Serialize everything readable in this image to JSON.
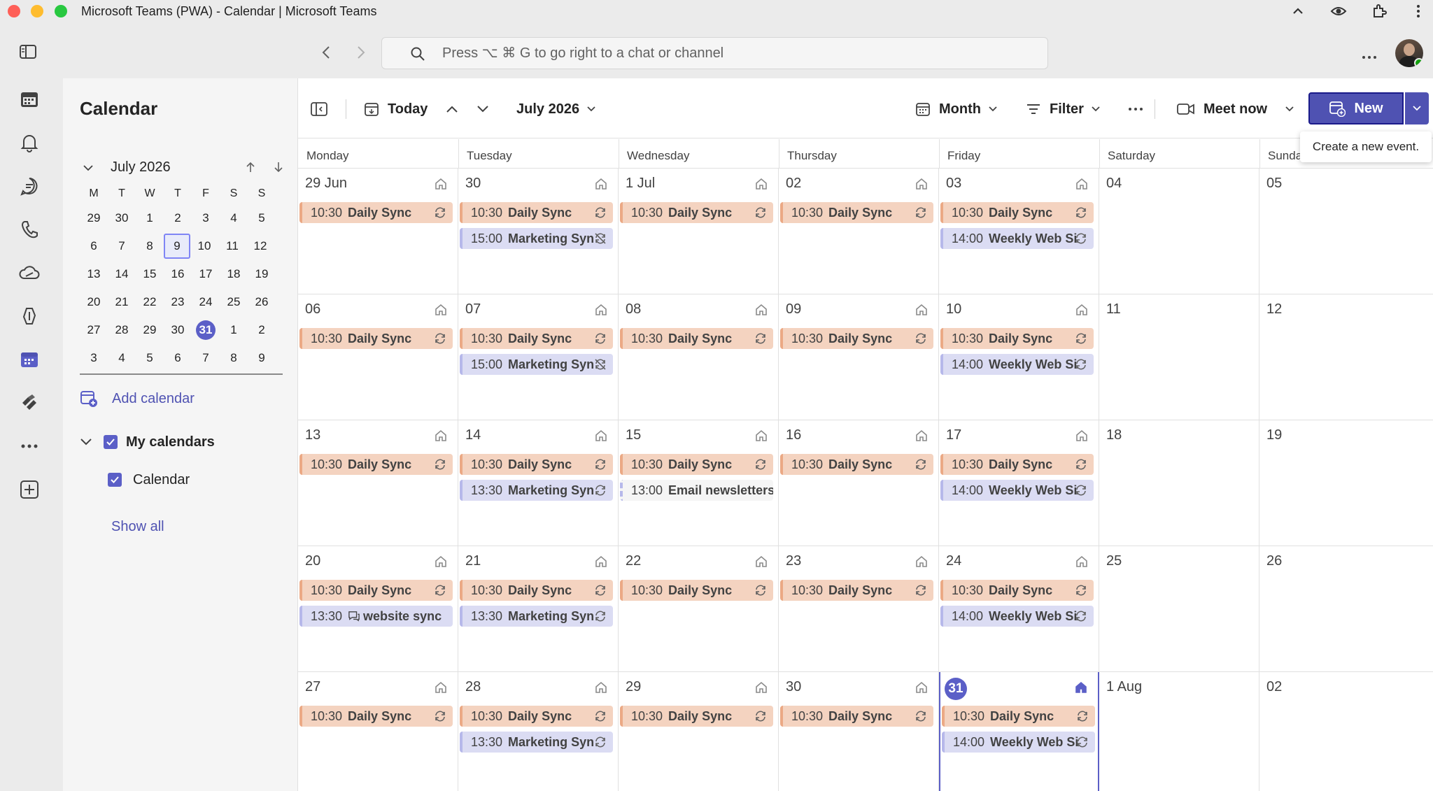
{
  "window": {
    "title": "Microsoft Teams (PWA) - Calendar | Microsoft Teams"
  },
  "search": {
    "placeholder": "Press ⌥ ⌘ G to go right to a chat or channel"
  },
  "sidebar": {
    "title": "Calendar",
    "mini_month": "July 2026",
    "dow": [
      "M",
      "T",
      "W",
      "T",
      "F",
      "S",
      "S"
    ],
    "weeks": [
      [
        "29",
        "30",
        "1",
        "2",
        "3",
        "4",
        "5"
      ],
      [
        "6",
        "7",
        "8",
        "9",
        "10",
        "11",
        "12"
      ],
      [
        "13",
        "14",
        "15",
        "16",
        "17",
        "18",
        "19"
      ],
      [
        "20",
        "21",
        "22",
        "23",
        "24",
        "25",
        "26"
      ],
      [
        "27",
        "28",
        "29",
        "30",
        "31",
        "1",
        "2"
      ],
      [
        "3",
        "4",
        "5",
        "6",
        "7",
        "8",
        "9"
      ]
    ],
    "add_calendar": "Add calendar",
    "my_calendars": "My calendars",
    "calendar_item": "Calendar",
    "show_all": "Show all"
  },
  "toolbar": {
    "today": "Today",
    "month_label": "July 2026",
    "view": "Month",
    "filter": "Filter",
    "meet_now": "Meet now",
    "new": "New",
    "tooltip": "Create a new event."
  },
  "grid": {
    "dow": [
      "Monday",
      "Tuesday",
      "Wednesday",
      "Thursday",
      "Friday",
      "Saturday",
      "Sunda"
    ],
    "weeks": [
      {
        "days": [
          "29 Jun",
          "30",
          "1 Jul",
          "02",
          "03",
          "04",
          "05"
        ],
        "events": [
          [
            {
              "time": "10:30",
              "name": "Daily Sync",
              "kind": "orange",
              "icon": "repeat"
            }
          ],
          [
            {
              "time": "10:30",
              "name": "Daily Sync",
              "kind": "orange",
              "icon": "repeat"
            },
            {
              "time": "15:00",
              "name": "Marketing Syn",
              "kind": "purple",
              "icon": "repeat-off"
            }
          ],
          [
            {
              "time": "10:30",
              "name": "Daily Sync",
              "kind": "orange",
              "icon": "repeat"
            }
          ],
          [
            {
              "time": "10:30",
              "name": "Daily Sync",
              "kind": "orange",
              "icon": "repeat"
            }
          ],
          [
            {
              "time": "10:30",
              "name": "Daily Sync",
              "kind": "orange",
              "icon": "repeat"
            },
            {
              "time": "14:00",
              "name": "Weekly Web Si",
              "kind": "purple",
              "icon": "repeat"
            }
          ],
          [],
          []
        ]
      },
      {
        "days": [
          "06",
          "07",
          "08",
          "09",
          "10",
          "11",
          "12"
        ],
        "events": [
          [
            {
              "time": "10:30",
              "name": "Daily Sync",
              "kind": "orange",
              "icon": "repeat"
            }
          ],
          [
            {
              "time": "10:30",
              "name": "Daily Sync",
              "kind": "orange",
              "icon": "repeat"
            },
            {
              "time": "15:00",
              "name": "Marketing Syn",
              "kind": "purple",
              "icon": "repeat-off"
            }
          ],
          [
            {
              "time": "10:30",
              "name": "Daily Sync",
              "kind": "orange",
              "icon": "repeat"
            }
          ],
          [
            {
              "time": "10:30",
              "name": "Daily Sync",
              "kind": "orange",
              "icon": "repeat"
            }
          ],
          [
            {
              "time": "10:30",
              "name": "Daily Sync",
              "kind": "orange",
              "icon": "repeat"
            },
            {
              "time": "14:00",
              "name": "Weekly Web Si",
              "kind": "purple",
              "icon": "repeat"
            }
          ],
          [],
          []
        ]
      },
      {
        "days": [
          "13",
          "14",
          "15",
          "16",
          "17",
          "18",
          "19"
        ],
        "events": [
          [
            {
              "time": "10:30",
              "name": "Daily Sync",
              "kind": "orange",
              "icon": "repeat"
            }
          ],
          [
            {
              "time": "10:30",
              "name": "Daily Sync",
              "kind": "orange",
              "icon": "repeat"
            },
            {
              "time": "13:30",
              "name": "Marketing Syn",
              "kind": "purple",
              "icon": "repeat"
            }
          ],
          [
            {
              "time": "10:30",
              "name": "Daily Sync",
              "kind": "orange",
              "icon": "repeat"
            },
            {
              "time": "13:00",
              "name": "Email newsletters",
              "kind": "plain",
              "icon": ""
            }
          ],
          [
            {
              "time": "10:30",
              "name": "Daily Sync",
              "kind": "orange",
              "icon": "repeat"
            }
          ],
          [
            {
              "time": "10:30",
              "name": "Daily Sync",
              "kind": "orange",
              "icon": "repeat"
            },
            {
              "time": "14:00",
              "name": "Weekly Web Si",
              "kind": "purple",
              "icon": "repeat"
            }
          ],
          [],
          []
        ]
      },
      {
        "days": [
          "20",
          "21",
          "22",
          "23",
          "24",
          "25",
          "26"
        ],
        "events": [
          [
            {
              "time": "10:30",
              "name": "Daily Sync",
              "kind": "orange",
              "icon": "repeat"
            },
            {
              "time": "13:30",
              "name": "website sync",
              "kind": "purple",
              "icon": "",
              "chat": true
            }
          ],
          [
            {
              "time": "10:30",
              "name": "Daily Sync",
              "kind": "orange",
              "icon": "repeat"
            },
            {
              "time": "13:30",
              "name": "Marketing Syn",
              "kind": "purple",
              "icon": "repeat"
            }
          ],
          [
            {
              "time": "10:30",
              "name": "Daily Sync",
              "kind": "orange",
              "icon": "repeat"
            }
          ],
          [
            {
              "time": "10:30",
              "name": "Daily Sync",
              "kind": "orange",
              "icon": "repeat"
            }
          ],
          [
            {
              "time": "10:30",
              "name": "Daily Sync",
              "kind": "orange",
              "icon": "repeat"
            },
            {
              "time": "14:00",
              "name": "Weekly Web Si",
              "kind": "purple",
              "icon": "repeat"
            }
          ],
          [],
          []
        ]
      },
      {
        "days": [
          "27",
          "28",
          "29",
          "30",
          "31",
          "1 Aug",
          "02"
        ],
        "events": [
          [
            {
              "time": "10:30",
              "name": "Daily Sync",
              "kind": "orange",
              "icon": "repeat"
            }
          ],
          [
            {
              "time": "10:30",
              "name": "Daily Sync",
              "kind": "orange",
              "icon": "repeat"
            },
            {
              "time": "13:30",
              "name": "Marketing Syn",
              "kind": "purple",
              "icon": "repeat"
            }
          ],
          [
            {
              "time": "10:30",
              "name": "Daily Sync",
              "kind": "orange",
              "icon": "repeat"
            }
          ],
          [
            {
              "time": "10:30",
              "name": "Daily Sync",
              "kind": "orange",
              "icon": "repeat"
            }
          ],
          [
            {
              "time": "10:30",
              "name": "Daily Sync",
              "kind": "orange",
              "icon": "repeat"
            },
            {
              "time": "14:00",
              "name": "Weekly Web Si",
              "kind": "purple",
              "icon": "repeat"
            }
          ],
          [],
          []
        ]
      }
    ]
  },
  "colors": {
    "accent": "#5b5fc7",
    "event_orange": "#f4d3c0",
    "event_purple": "#dbdcf3"
  }
}
